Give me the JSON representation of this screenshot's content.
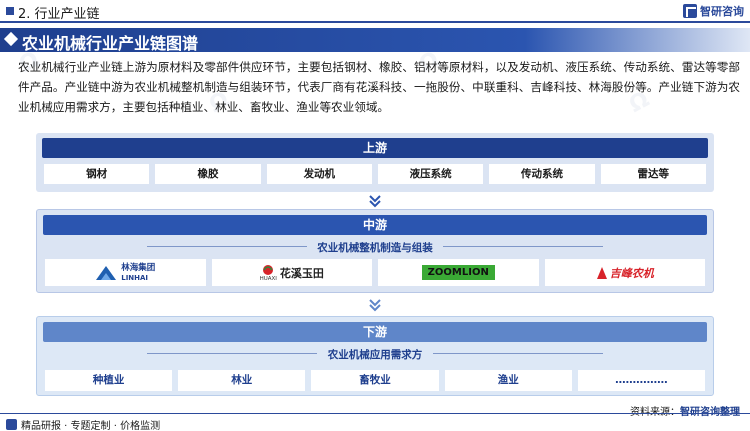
{
  "header": {
    "section_label": "2. 行业产业链",
    "brand_name": "智研咨询",
    "brand_color": "#2b4a9b"
  },
  "banner": {
    "title": "农业机械行业产业链图谱"
  },
  "description": "农业机械行业产业链上游为原材料及零部件供应环节，主要包括钢材、橡胶、铝材等原材料，以及发动机、液压系统、传动系统、雷达等零部件产品。产业链中游为农业机械整机制造与组装环节，代表厂商有花溪科技、一拖股份、中联重科、吉峰科技、林海股份等。产业链下游为农业机械应用需求方，主要包括种植业、林业、畜牧业、渔业等农业领域。",
  "upstream": {
    "label": "上游",
    "items": [
      "钢材",
      "橡胶",
      "发动机",
      "液压系统",
      "传动系统",
      "雷达等"
    ]
  },
  "midstream": {
    "label": "中游",
    "subtitle": "农业机械整机制造与组装",
    "logos": [
      {
        "name": "林海集团",
        "sub": "LINHAI",
        "icon": "linhai-logo"
      },
      {
        "name": "花溪玉田",
        "sub": "HUAXI",
        "icon": "huaxi-logo"
      },
      {
        "name": "ZOOMLION",
        "icon": "zoomlion-logo"
      },
      {
        "name": "吉峰农机",
        "icon": "jifeng-logo"
      }
    ]
  },
  "downstream": {
    "label": "下游",
    "subtitle": "农业机械应用需求方",
    "items": [
      "种植业",
      "林业",
      "畜牧业",
      "渔业",
      "……………"
    ]
  },
  "footer": {
    "left": "精品研报 · 专题定制 · 价格监测",
    "source_label": "资料来源：",
    "source_value": "智研咨询整理"
  }
}
